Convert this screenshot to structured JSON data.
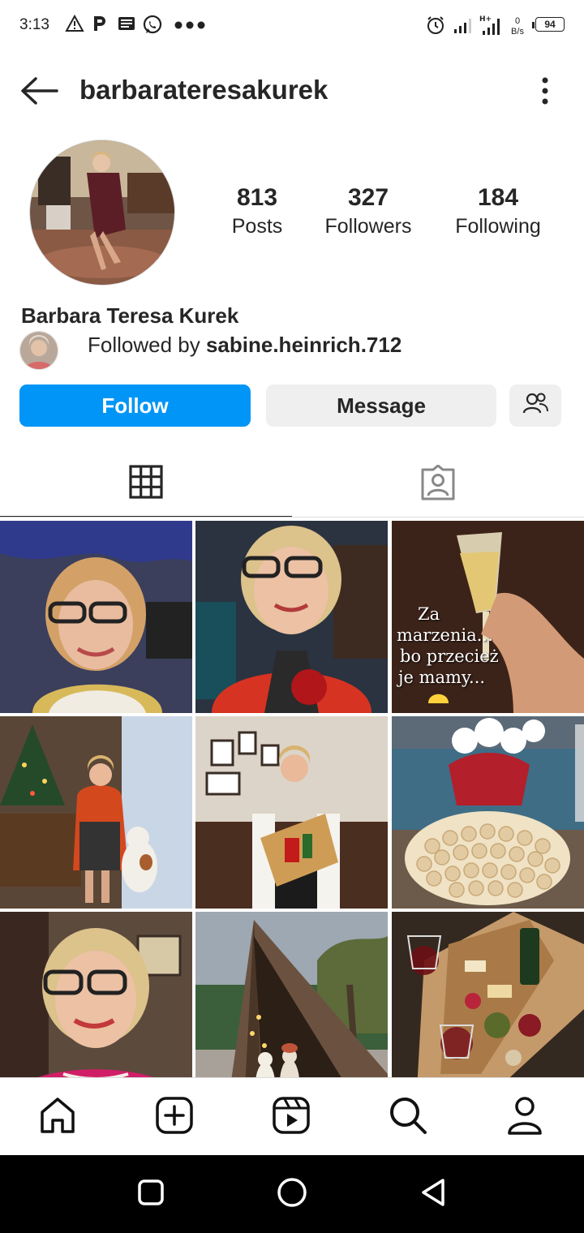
{
  "status_bar": {
    "time": "3:13",
    "icons_left": [
      "warning-icon",
      "parking-icon",
      "news-icon",
      "whatsapp-icon",
      "more-dots-icon"
    ],
    "icons_right": [
      "alarm-icon",
      "signal-icon",
      "signal-h-plus-icon",
      "data-rate-icon",
      "battery-icon"
    ],
    "data_rate_value": "0",
    "data_rate_unit": "B/s",
    "battery_level": "94"
  },
  "header": {
    "username": "barbarateresakurek"
  },
  "profile": {
    "stats": [
      {
        "value": "813",
        "label": "Posts"
      },
      {
        "value": "327",
        "label": "Followers"
      },
      {
        "value": "184",
        "label": "Following"
      }
    ],
    "full_name": "Barbara Teresa Kurek",
    "followed_by_prefix": "Followed by ",
    "followed_by_user": "sabine.heinrich.712"
  },
  "actions": {
    "follow_label": "Follow",
    "message_label": "Message"
  },
  "grid": {
    "caption_lines": [
      "Za",
      "marzenia...",
      "bo przecież",
      "je mamy..."
    ]
  },
  "colors": {
    "accent": "#0095f6",
    "text": "#262626",
    "button_gray": "#efefef"
  }
}
